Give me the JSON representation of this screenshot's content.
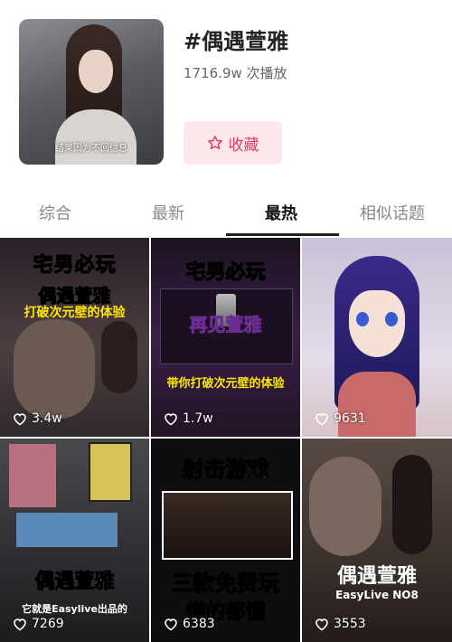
{
  "header": {
    "cover_caption": "结果因为不回信息",
    "title": "#偶遇萱雅",
    "play_count": "1716.9w 次播放",
    "favorite_label": "收藏"
  },
  "tabs": [
    {
      "label": "综合"
    },
    {
      "label": "最新"
    },
    {
      "label": "最热"
    },
    {
      "label": "相似话题"
    }
  ],
  "videos": [
    {
      "text1": "宅男必玩",
      "text2": "偶遇萱雅",
      "text3": "打破次元壁的体验",
      "likes": "3.4w"
    },
    {
      "text1": "宅男必玩",
      "text2": "再见萱雅",
      "text3": "带你打破次元壁的体验",
      "likes": "1.7w"
    },
    {
      "likes": "9631"
    },
    {
      "text1": "偶遇萱雅",
      "text2": "它就是Easylive出品的",
      "likes": "7269"
    },
    {
      "text1": "射击游戏",
      "text2": "三款免费玩",
      "text3": "懂的都懂",
      "likes": "6383"
    },
    {
      "text1": "偶遇萱雅",
      "text2": "EasyLive NO8",
      "likes": "3553"
    }
  ],
  "colors": {
    "accent": "#e8395f",
    "fav_bg": "#fde8ec",
    "yellow_text": "#ffe600"
  }
}
